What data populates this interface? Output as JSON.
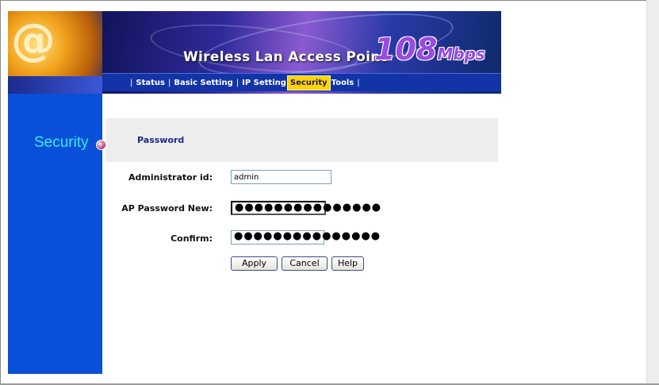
{
  "header": {
    "title": "Wireless Lan Access Point",
    "speed_num": "108",
    "speed_unit": "Mbps",
    "nav": [
      {
        "label": "Status"
      },
      {
        "label": "Basic  Setting"
      },
      {
        "label": "IP Setting"
      },
      {
        "label": "Security"
      },
      {
        "label": "Tools"
      }
    ]
  },
  "sidebar": {
    "section_title": "Security"
  },
  "form": {
    "panel_title": "Password",
    "admin_label": "Administrator id:",
    "admin_value": "admin",
    "new_label": "AP Password New:",
    "new_value": "●●●●●●●●●●●●●●●",
    "confirm_label": "Confirm:",
    "confirm_value": "●●●●●●●●●●●●●●●"
  },
  "buttons": {
    "apply": "Apply",
    "cancel": "Cancel",
    "help": "Help"
  },
  "colors": {
    "sidebar": "#0a4fd8",
    "nav_active": "#ffd400",
    "section_title": "#33eaff"
  }
}
